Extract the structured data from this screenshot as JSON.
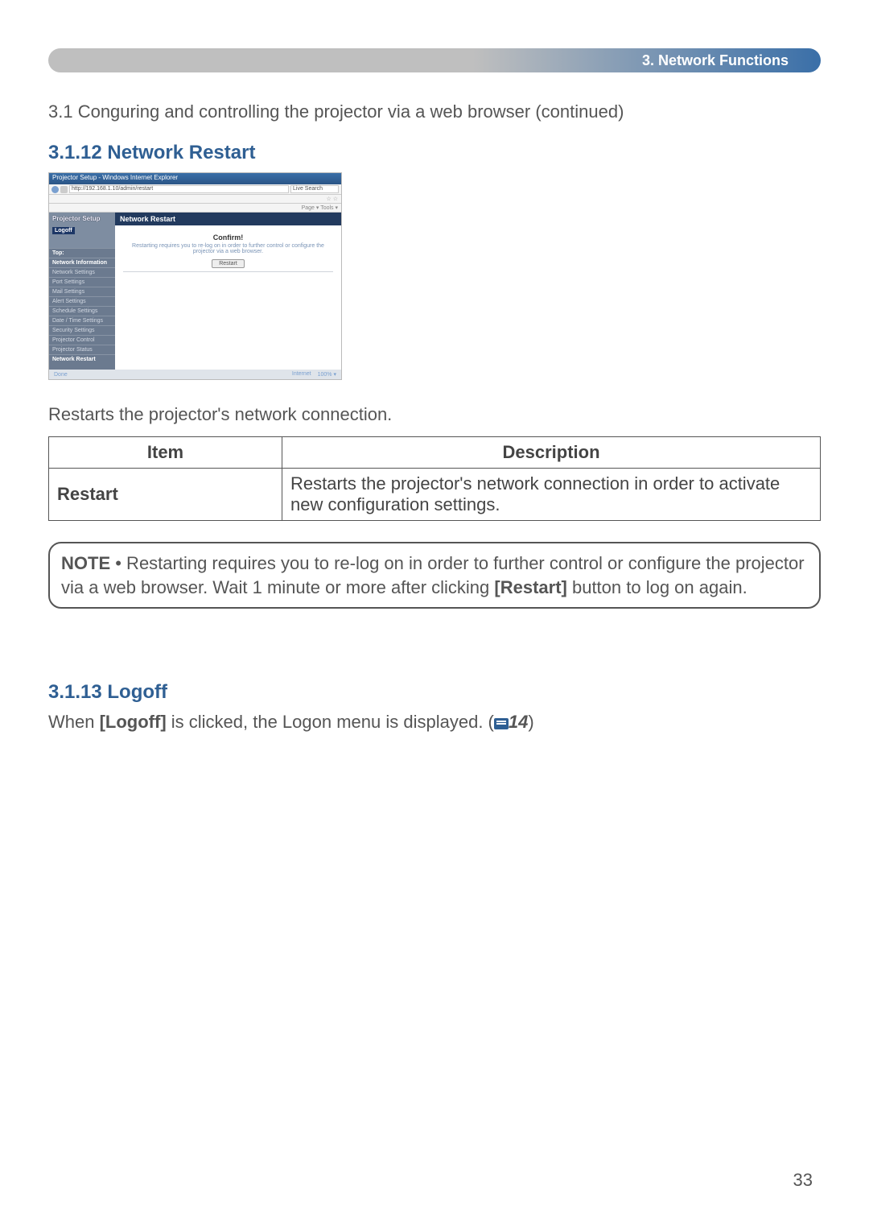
{
  "header": {
    "chapter": "3. Network Functions"
  },
  "section_title": "3.1 Conguring and controlling the projector via a web browser (continued)",
  "subsec1": {
    "heading": "3.1.12 Network Restart"
  },
  "screenshot": {
    "window_title": "Projector Setup - Windows Internet Explorer",
    "url": "http://192.168.1.10/admin/restart",
    "search_hint": "Live Search",
    "tabs_text": "Page ▾  Tools ▾",
    "side_header": "Projector Setup",
    "logoff": "Logoff",
    "side_items": [
      "Top:",
      "Network Information",
      "Network Settings",
      "Port Settings",
      "Mail Settings",
      "Alert Settings",
      "Schedule Settings",
      "Date / Time Settings",
      "Security Settings",
      "Projector Control",
      "Projector Status",
      "Network Restart"
    ],
    "main_title": "Network Restart",
    "confirm": "Confirm!",
    "message": "Restarting requires you to re-log on in order to further control or configure the projector via a web browser.",
    "button": "Restart",
    "status_left": "Done",
    "status_mid": "Internet",
    "status_right": "100% ▾"
  },
  "desc_text": "Restarts the projector's network connection.",
  "table": {
    "h1": "Item",
    "h2": "Description",
    "row1_item": "Restart",
    "row1_desc": "Restarts the projector's network connection in order to activate new configuration settings."
  },
  "note": {
    "label": "NOTE",
    "text1": " • Restarting requires you to re-log on in order to further control or configure the projector via a web browser. Wait 1 minute or more after clicking ",
    "restart": "[Restart]",
    "text2": " button to log on again."
  },
  "subsec2": {
    "heading": "3.1.13 Logoff",
    "text_pre": "When ",
    "logoff_bold": "[Logoff]",
    "text_mid": " is clicked, the Logon menu is displayed. (",
    "ref": "14",
    "text_post": ")"
  },
  "page_number": "33"
}
